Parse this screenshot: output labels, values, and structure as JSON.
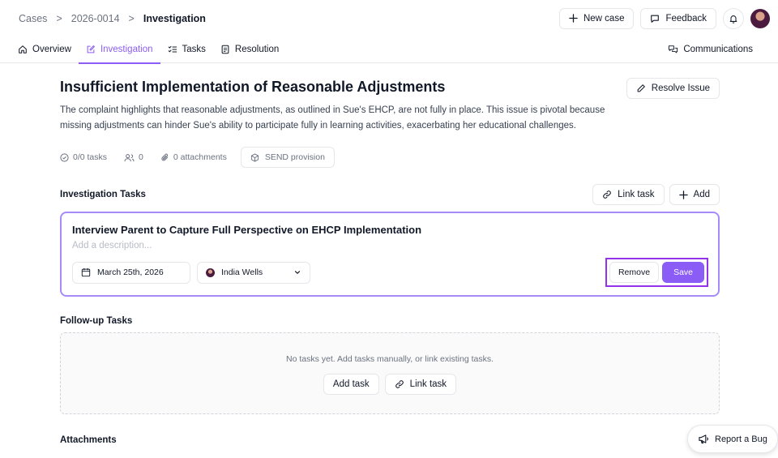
{
  "breadcrumb": {
    "items": [
      "Cases",
      "2026-0014"
    ],
    "current": "Investigation",
    "separator": ">"
  },
  "header": {
    "new_case_label": "New case",
    "feedback_label": "Feedback"
  },
  "tabs": [
    {
      "label": "Overview",
      "icon": "home-icon",
      "active": false
    },
    {
      "label": "Investigation",
      "icon": "edit-icon",
      "active": true
    },
    {
      "label": "Tasks",
      "icon": "checklist-icon",
      "active": false
    },
    {
      "label": "Resolution",
      "icon": "document-icon",
      "active": false
    }
  ],
  "communications_tab": {
    "label": "Communications",
    "icon": "chat-icon"
  },
  "issue": {
    "title": "Insufficient Implementation of Reasonable Adjustments",
    "description": "The complaint highlights that reasonable adjustments, as outlined in Sue's EHCP, are not fully in place. This issue is pivotal because missing adjustments can hinder Sue's ability to participate fully in learning activities, exacerbating her educational challenges.",
    "resolve_label": "Resolve Issue",
    "meta": {
      "tasks": "0/0 tasks",
      "people": "0",
      "attachments": "0 attachments",
      "send_provision": "SEND provision"
    }
  },
  "investigation_tasks": {
    "title": "Investigation Tasks",
    "link_task_label": "Link task",
    "add_label": "Add",
    "draft": {
      "title": "Interview Parent to Capture Full Perspective on EHCP Implementation",
      "description_placeholder": "Add a description...",
      "date": "March 25th, 2026",
      "assignee": "India Wells",
      "remove_label": "Remove",
      "save_label": "Save"
    }
  },
  "followup_tasks": {
    "title": "Follow-up Tasks",
    "empty_text": "No tasks yet. Add tasks manually, or link existing tasks.",
    "add_task_label": "Add task",
    "link_task_label": "Link task"
  },
  "attachments": {
    "title": "Attachments"
  },
  "report_bug_label": "Report a Bug",
  "colors": {
    "accent": "#8b5cf6",
    "highlight_border": "#9333ea",
    "text": "#111827",
    "muted": "#6b7280"
  }
}
